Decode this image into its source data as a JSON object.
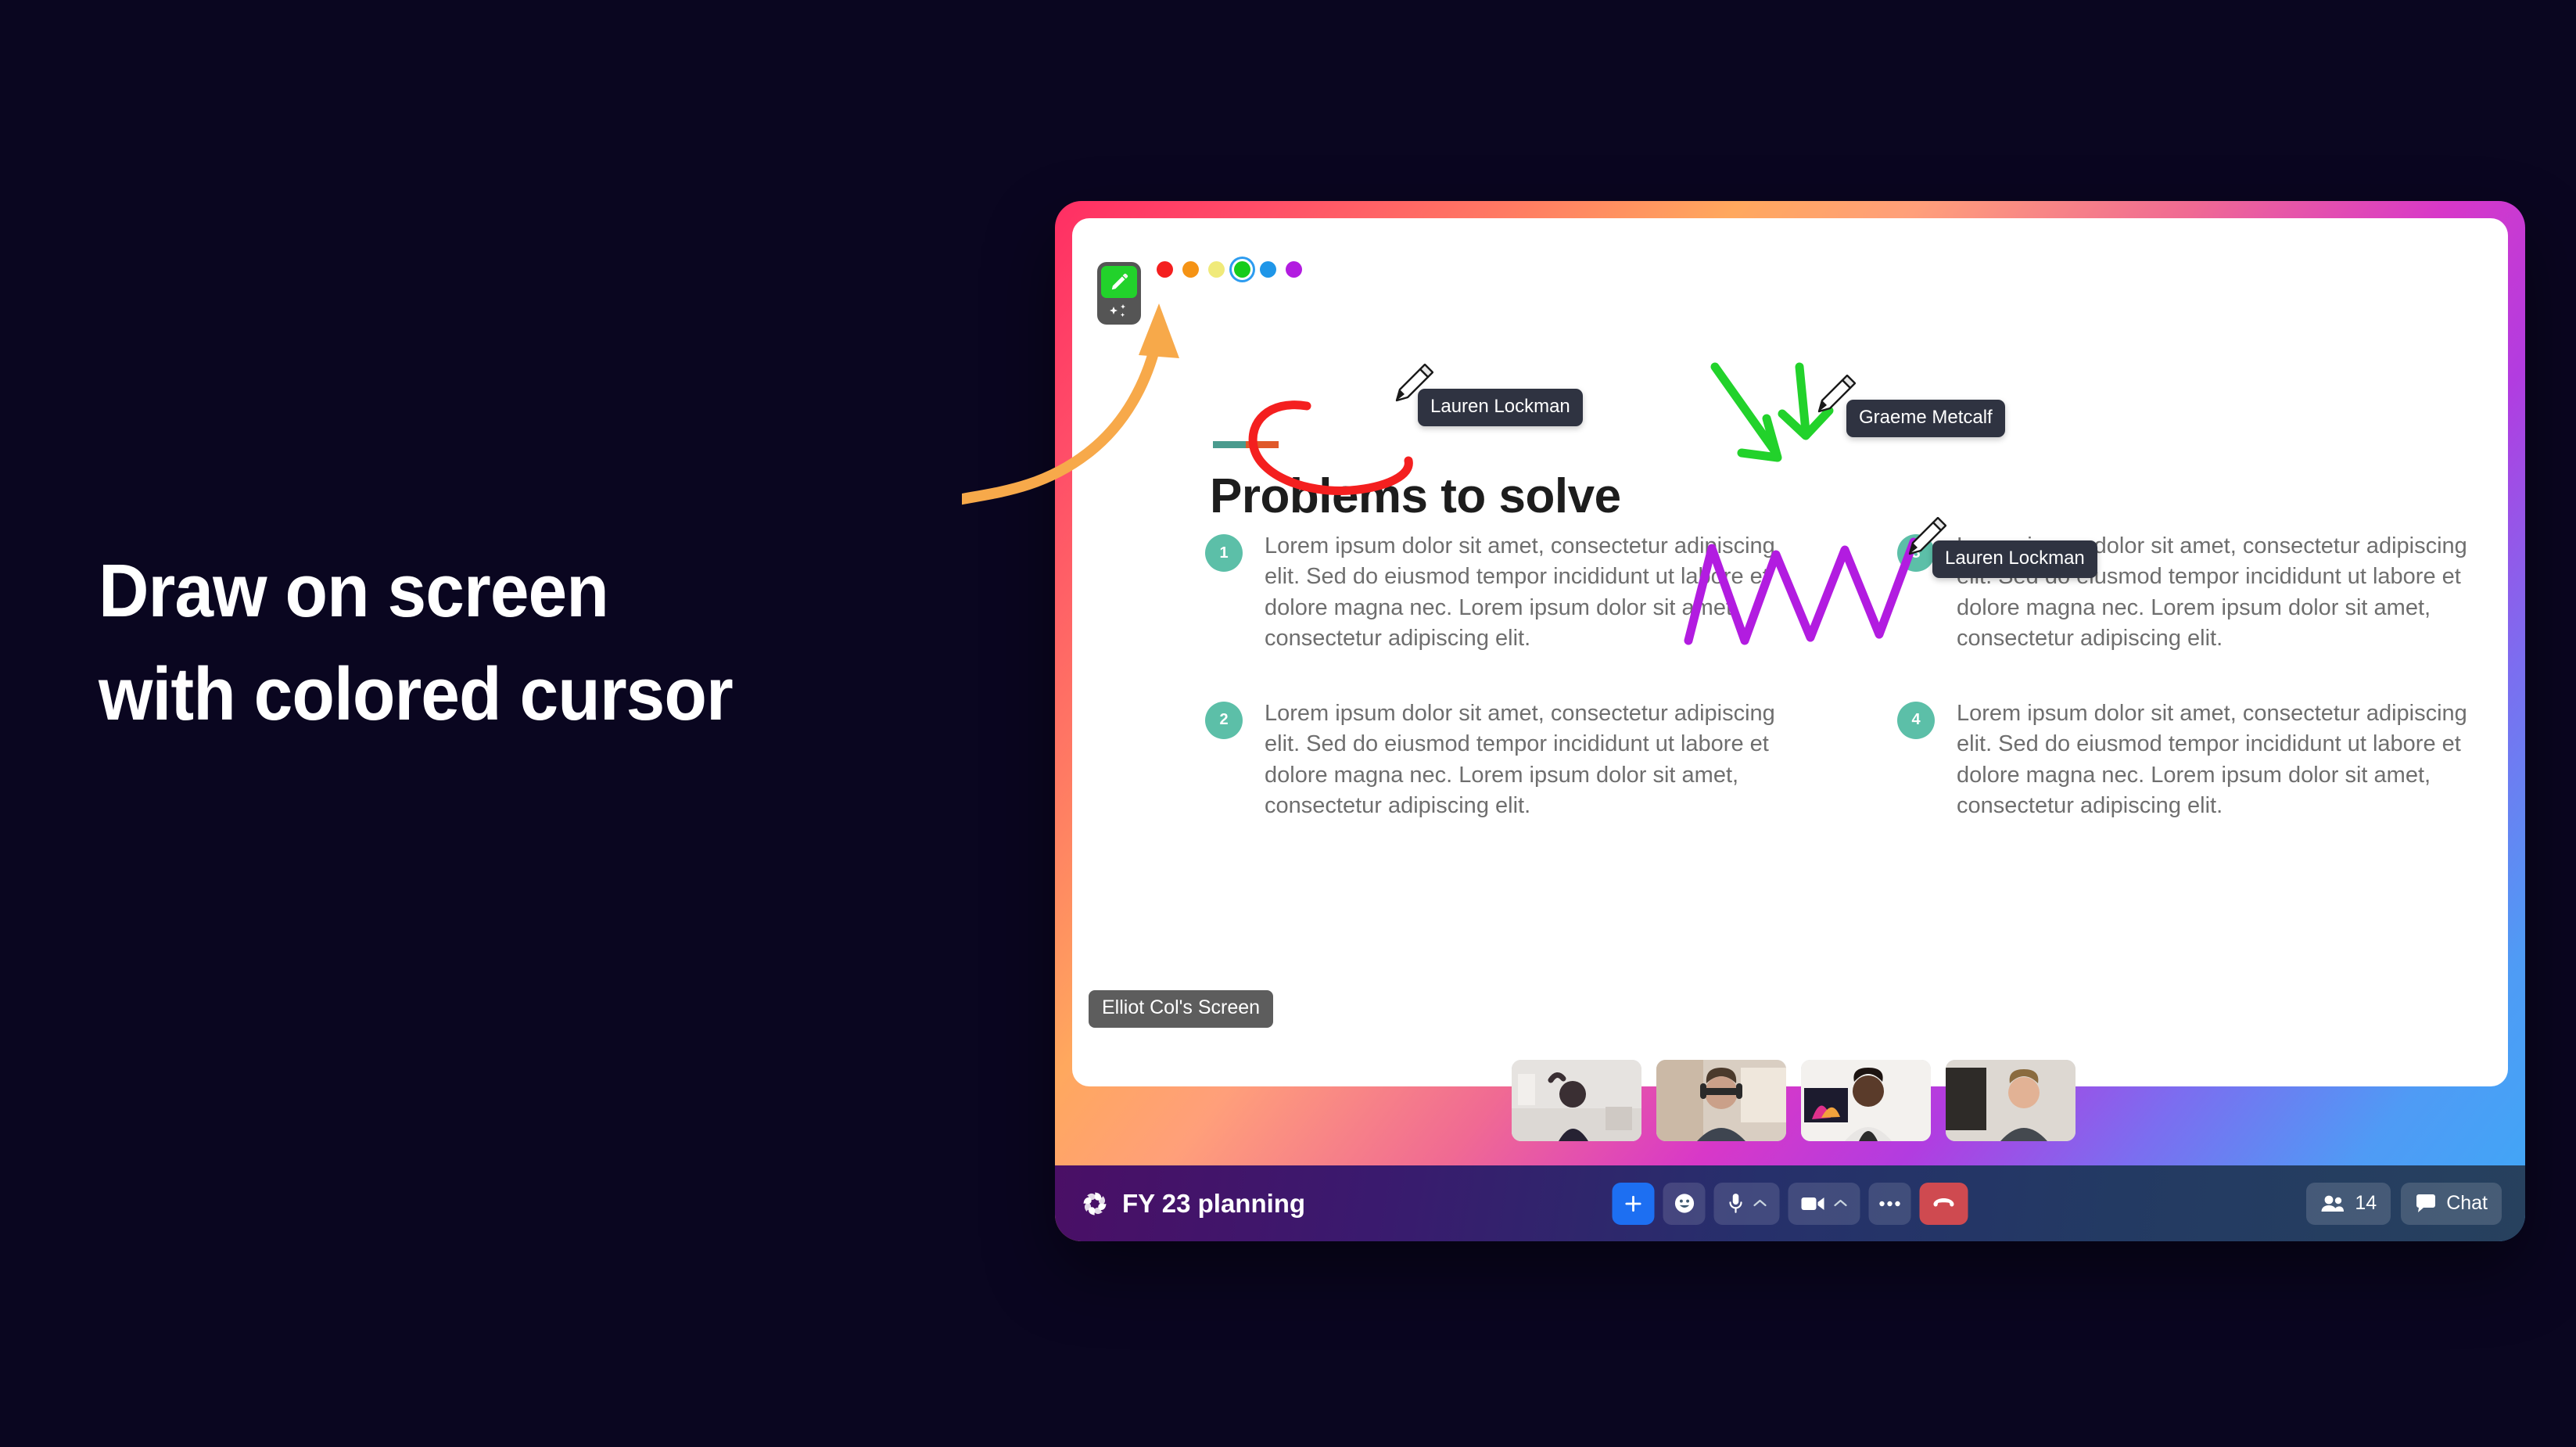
{
  "headline": {
    "line1": "Draw on screen",
    "line2": "with colored cursor"
  },
  "toolbar": {
    "pen_tool_label": "pen-tool",
    "sparkle_tool_label": "effects-tool",
    "colors": [
      {
        "name": "red",
        "hex": "#f41f1f",
        "selected": false
      },
      {
        "name": "orange",
        "hex": "#f59315",
        "selected": false
      },
      {
        "name": "yellow",
        "hex": "#f0ea7a",
        "selected": false
      },
      {
        "name": "green",
        "hex": "#17cc1b",
        "selected": true
      },
      {
        "name": "blue",
        "hex": "#1f96e8",
        "selected": false
      },
      {
        "name": "purple",
        "hex": "#b21ce0",
        "selected": false
      }
    ]
  },
  "slide": {
    "title": "Problems to solve",
    "accent_color_left": "#4a9b8e",
    "accent_color_right": "#e0592a",
    "bullet_body": "Lorem ipsum dolor sit amet, consectetur adipiscing elit. Sed do eiusmod tempor incididunt ut labore et dolore magna nec. Lorem ipsum dolor sit amet, consectetur adipiscing elit.",
    "bullets": [
      {
        "number": "1",
        "text": "Lorem ipsum dolor sit amet, consectetur adipiscing elit. Sed do eiusmod tempor incididunt ut labore et dolore magna nec. Lorem ipsum dolor sit amet, consectetur adipiscing elit."
      },
      {
        "number": "2",
        "text": "Lorem ipsum dolor sit amet, consectetur adipiscing elit. Sed do eiusmod tempor incididunt ut labore et dolore magna nec. Lorem ipsum dolor sit amet, consectetur adipiscing elit."
      },
      {
        "number": "3",
        "text": "Lorem ipsum dolor sit amet, consectetur adipiscing elit. Sed do eiusmod tempor incididunt ut labore et dolore magna nec. Lorem ipsum dolor sit amet, consectetur adipiscing elit."
      },
      {
        "number": "4",
        "text": "Lorem ipsum dolor sit amet, consectetur adipiscing elit. Sed do eiusmod tempor incididunt ut labore et dolore magna nec. Lorem ipsum dolor sit amet, consectetur adipiscing elit."
      }
    ]
  },
  "annotations": {
    "red_circle_author": "Lauren Lockman",
    "red_circle_color": "#f41f1f",
    "green_arrows_author": "Graeme Metcalf",
    "green_arrows_color": "#22d22b",
    "purple_scribble_author": "Lauren Lockman",
    "purple_scribble_color": "#b21ce0",
    "callout_arrow_color": "#f7a94a"
  },
  "presenter_label": "Elliot Col's Screen",
  "participants": [
    {
      "name": "participant-1"
    },
    {
      "name": "participant-2"
    },
    {
      "name": "participant-3"
    },
    {
      "name": "participant-4"
    }
  ],
  "meeting_bar": {
    "title": "FY 23 planning",
    "logo": "pinwheel-logo",
    "controls": [
      {
        "name": "add",
        "icon": "plus-icon",
        "label": ""
      },
      {
        "name": "react",
        "icon": "emoji-icon",
        "label": ""
      },
      {
        "name": "mic",
        "icon": "microphone-icon",
        "label": ""
      },
      {
        "name": "camera",
        "icon": "camera-icon",
        "label": ""
      },
      {
        "name": "more",
        "icon": "ellipsis-icon",
        "label": ""
      },
      {
        "name": "hangup",
        "icon": "phone-down-icon",
        "label": ""
      }
    ],
    "participant_count": "14",
    "chat_label": "Chat"
  }
}
